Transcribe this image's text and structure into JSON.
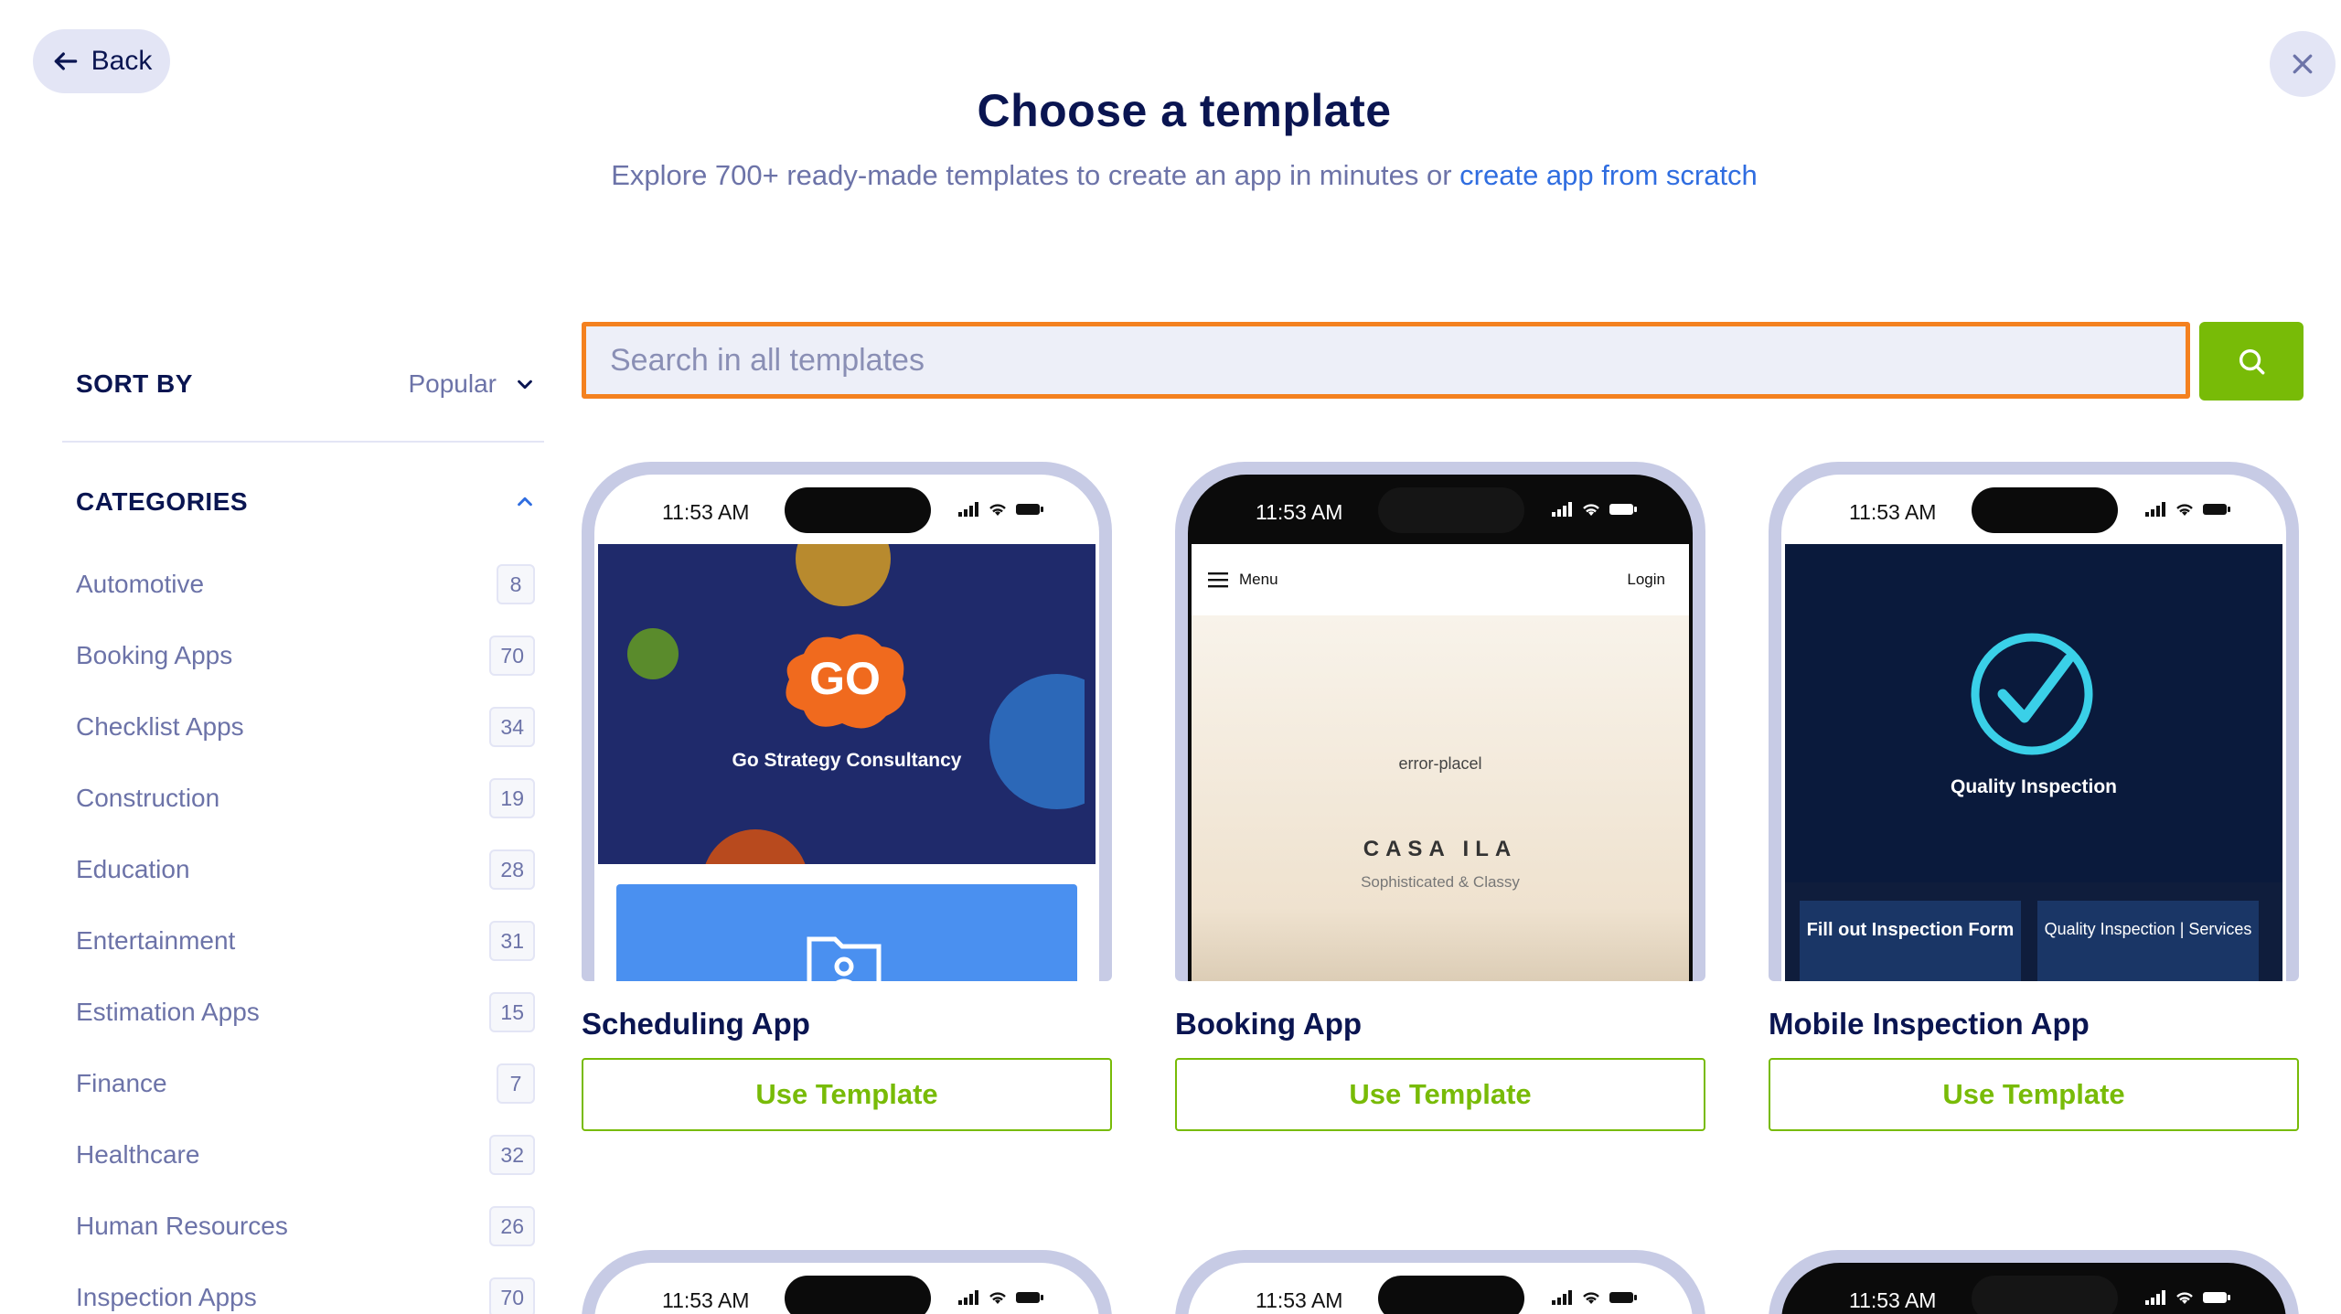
{
  "header": {
    "back_label": "Back",
    "title": "Choose a template",
    "subtitle_prefix": "Explore 700+ ready-made templates to create an app in minutes or ",
    "subtitle_link": "create app from scratch"
  },
  "search": {
    "placeholder": "Search in all templates",
    "value": ""
  },
  "sidebar": {
    "sort_by_label": "SORT BY",
    "sort_value": "Popular",
    "categories_label": "CATEGORIES",
    "categories": [
      {
        "label": "Automotive",
        "count": "8"
      },
      {
        "label": "Booking Apps",
        "count": "70"
      },
      {
        "label": "Checklist Apps",
        "count": "34"
      },
      {
        "label": "Construction",
        "count": "19"
      },
      {
        "label": "Education",
        "count": "28"
      },
      {
        "label": "Entertainment",
        "count": "31"
      },
      {
        "label": "Estimation Apps",
        "count": "15"
      },
      {
        "label": "Finance",
        "count": "7"
      },
      {
        "label": "Healthcare",
        "count": "32"
      },
      {
        "label": "Human Resources",
        "count": "26"
      },
      {
        "label": "Inspection Apps",
        "count": "70"
      }
    ]
  },
  "templates": [
    {
      "title": "Scheduling App",
      "button": "Use Template",
      "time": "11:53 AM",
      "preview_text": "Go Strategy Consultancy",
      "logo_text": "GO"
    },
    {
      "title": "Booking App",
      "button": "Use Template",
      "time": "11:53 AM",
      "nav_menu": "Menu",
      "nav_login": "Login",
      "error_text": "error-placel",
      "brand": "CASA ILA",
      "tagline": "Sophisticated & Classy"
    },
    {
      "title": "Mobile Inspection App",
      "button": "Use Template",
      "time": "11:53 AM",
      "preview_text": "Quality Inspection",
      "tile1": "Fill out Inspection Form",
      "tile2": "Quality Inspection | Services"
    }
  ],
  "bottom_row": [
    {
      "time": "11:53 AM"
    },
    {
      "time": "11:53 AM"
    },
    {
      "time": "11:53 AM"
    }
  ],
  "colors": {
    "accent_green": "#78bb07",
    "search_border": "#f4811f",
    "navy": "#0a1551",
    "link_blue": "#2f6de0"
  }
}
